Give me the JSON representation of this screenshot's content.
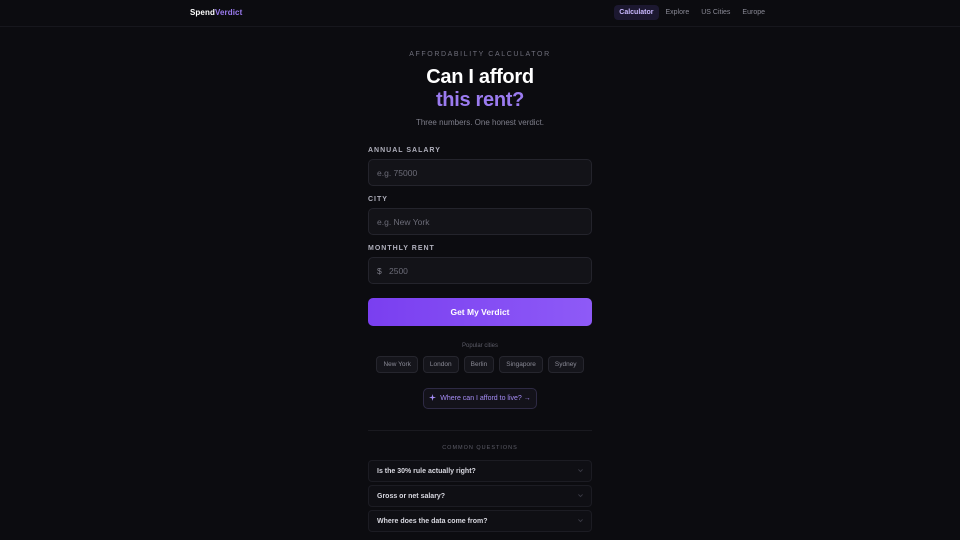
{
  "nav": {
    "brand_part1": "Spend",
    "brand_part2": "Verdict",
    "links": [
      {
        "label": "Calculator",
        "active": true
      },
      {
        "label": "Explore",
        "active": false
      },
      {
        "label": "US Cities",
        "active": false
      },
      {
        "label": "Europe",
        "active": false
      }
    ]
  },
  "hero": {
    "eyebrow": "AFFORDABILITY CALCULATOR",
    "title_line1": "Can I afford",
    "title_line2": "this rent?",
    "subtitle": "Three numbers. One honest verdict."
  },
  "form": {
    "salary": {
      "label": "ANNUAL SALARY",
      "placeholder": "e.g. 75000",
      "value": ""
    },
    "city": {
      "label": "CITY",
      "placeholder": "e.g. New York",
      "value": ""
    },
    "rent": {
      "label": "MONTHLY RENT",
      "prefix": "$",
      "placeholder": "2500",
      "value": ""
    },
    "submit_label": "Get My Verdict"
  },
  "popular": {
    "label": "Popular cities",
    "cities": [
      "New York",
      "London",
      "Berlin",
      "Singapore",
      "Sydney"
    ]
  },
  "explore": {
    "icon": "sparkle-icon",
    "label": "Where can I afford to live? →"
  },
  "faq": {
    "title": "COMMON QUESTIONS",
    "items": [
      "Is the 30% rule actually right?",
      "Gross or net salary?",
      "Where does the data come from?"
    ]
  },
  "colors": {
    "background": "#0c0c10",
    "accent": "#9b7bf0",
    "button_gradient_start": "#7a3ff0",
    "button_gradient_end": "#8e5af7"
  }
}
